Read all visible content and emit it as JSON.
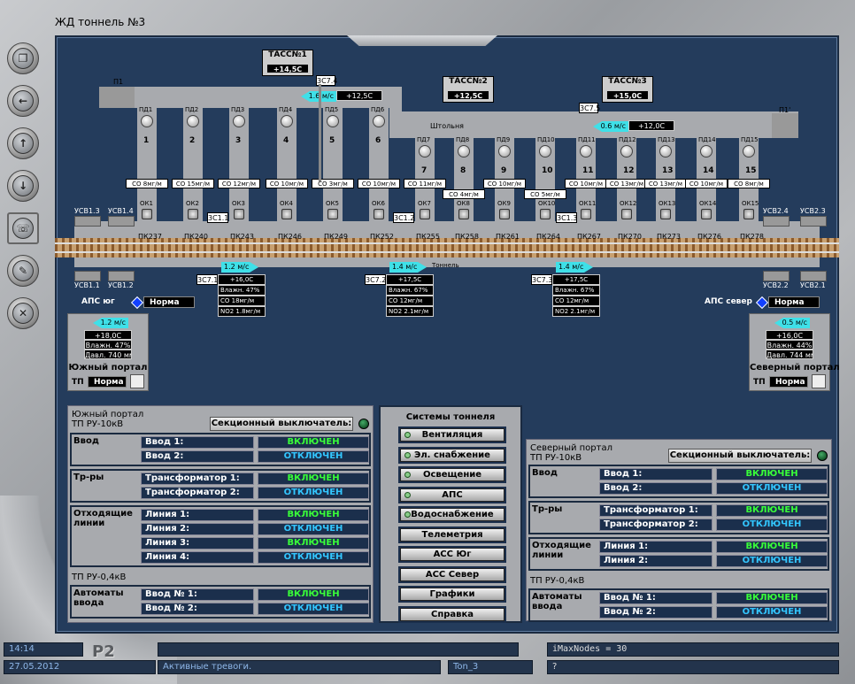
{
  "title": "ЖД тоннель №3",
  "sidebar": [
    "windows-icon",
    "back-icon",
    "up-icon",
    "down-icon",
    "alarm-icon",
    "report-icon",
    "disabled-icon"
  ],
  "tass": [
    {
      "name": "ТАСС№1",
      "temp": "+14,5С"
    },
    {
      "name": "ТАСС№2",
      "temp": "+12,5С"
    },
    {
      "name": "ТАСС№3",
      "temp": "+15,0С"
    }
  ],
  "top": {
    "p1": "П1",
    "p1r": "П1'",
    "sc74": "3С7.4",
    "sc75": "3С7.5",
    "air1_speed": "1.6 м/с",
    "air1_temp": "+12,5С",
    "air2_speed": "0.6 м/с",
    "air2_temp": "+12,0С",
    "shaft": "Штольня"
  },
  "shafts": [
    {
      "pd": "ПД1",
      "n": "1",
      "co": "СО 8мг/м",
      "ok": "ОК1"
    },
    {
      "pd": "ПД2",
      "n": "2",
      "co": "СО 15мг/м",
      "ok": "ОК2"
    },
    {
      "pd": "ПД3",
      "n": "3",
      "co": "СО 12мг/м",
      "ok": "ОК3"
    },
    {
      "pd": "ПД4",
      "n": "4",
      "co": "СО 10мг/м",
      "ok": "ОК4"
    },
    {
      "pd": "ПД5",
      "n": "5",
      "co": "СО 3мг/м",
      "ok": "ОК5"
    },
    {
      "pd": "ПД6",
      "n": "6",
      "co": "СО 10мг/м",
      "ok": "ОК6"
    },
    {
      "pd": "ПД7",
      "n": "7",
      "co": "СО 11мг/м",
      "ok": "ОК7"
    },
    {
      "pd": "ПД8",
      "n": "8",
      "co": "СО 4мг/м",
      "ok": "ОК8"
    },
    {
      "pd": "ПД9",
      "n": "9",
      "co": "СО 10мг/м",
      "ok": "ОК9"
    },
    {
      "pd": "ПД10",
      "n": "10",
      "co": "СО 5мг/м",
      "ok": "ОК10"
    },
    {
      "pd": "ПД11",
      "n": "11",
      "co": "СО 10мг/м",
      "ok": "ОК11"
    },
    {
      "pd": "ПД12",
      "n": "12",
      "co": "СО 13мг/м",
      "ok": "ОК12"
    },
    {
      "pd": "ПД13",
      "n": "13",
      "co": "СО 13мг/м",
      "ok": "ОК13"
    },
    {
      "pd": "ПД14",
      "n": "14",
      "co": "СО 10мг/м",
      "ok": "ОК14"
    },
    {
      "pd": "ПД15",
      "n": "15",
      "co": "СО 8мг/м",
      "ok": "ОК15"
    }
  ],
  "pk": [
    "ПК237",
    "ПК240",
    "ПК243",
    "ПК246",
    "ПК249",
    "ПК252",
    "ПК255",
    "ПК258",
    "ПК261",
    "ПК264",
    "ПК267",
    "ПК270",
    "ПК273",
    "ПК276",
    "ПК278"
  ],
  "sc": {
    "s71": "3С1.1",
    "s72": "3С1.2",
    "s73": "3С1.3"
  },
  "usv": {
    "u13": "УСВ1.3",
    "u14": "УСВ1.4",
    "u11": "УСВ1.1",
    "u12": "УСВ1.2",
    "u24": "УСВ2.4",
    "u23": "УСВ2.3",
    "u22": "УСВ2.2",
    "u21": "УСВ2.1"
  },
  "tunnel_label": "Тоннель",
  "sensors": [
    {
      "id": "3С7.1",
      "speed": "1.2 м/с",
      "temp": "+16,0С",
      "hum": "Влажн. 47%",
      "co": "СО 18мг/м",
      "no2": "NO2 1.8мг/м"
    },
    {
      "id": "3С7.2",
      "speed": "1.4 м/с",
      "temp": "+17,5С",
      "hum": "Влажн. 67%",
      "co": "СО 12мг/м",
      "no2": "NO2 2.1мг/м"
    },
    {
      "id": "3С7.3",
      "speed": "1.4 м/с",
      "temp": "+17,5С",
      "hum": "Влажн. 67%",
      "co": "СО 12мг/м",
      "no2": "NO2 2.1мг/м"
    }
  ],
  "aps": {
    "south": "АПС юг",
    "north": "АПС север",
    "state": "Норма"
  },
  "south_portal": {
    "speed": "1.2 м/с",
    "temp": "+18,0С",
    "hum": "Влажн. 47%",
    "press": "Давл. 740 мм",
    "name": "Южный портал",
    "tp": "ТП",
    "tp_state": "Норма"
  },
  "north_portal": {
    "speed": "0.5 м/с",
    "temp": "+16,0С",
    "hum": "Влажн. 44%",
    "press": "Давл. 744 мм",
    "name": "Северный портал",
    "tp": "ТП",
    "tp_state": "Норма"
  },
  "labels": {
    "sec_switch": "Секционный выключатель:",
    "vvod": "Ввод",
    "trans": "Тр-ры",
    "lines": "Отходящие линии",
    "tp04": "ТП РУ-0,4кВ",
    "auto": "Автоматы ввода",
    "on": "ВКЛЮЧЕН",
    "off": "ОТКЛЮЧЕН"
  },
  "south": {
    "title": "Южный портал\nТП РУ-10кВ",
    "vvod": [
      [
        "Ввод 1:",
        "on"
      ],
      [
        "Ввод 2:",
        "off"
      ]
    ],
    "trans": [
      [
        "Трансформатор 1:",
        "on"
      ],
      [
        "Трансформатор 2:",
        "off"
      ]
    ],
    "lines": [
      [
        "Линия 1:",
        "on"
      ],
      [
        "Линия 2:",
        "off"
      ],
      [
        "Линия 3:",
        "on"
      ],
      [
        "Линия 4:",
        "off"
      ]
    ],
    "auto": [
      [
        "Ввод № 1:",
        "on"
      ],
      [
        "Ввод № 2:",
        "off"
      ]
    ]
  },
  "north": {
    "title": "Северный портал\nТП РУ-10кВ",
    "vvod": [
      [
        "Ввод 1:",
        "on"
      ],
      [
        "Ввод 2:",
        "off"
      ]
    ],
    "trans": [
      [
        "Трансформатор 1:",
        "on"
      ],
      [
        "Трансформатор 2:",
        "off"
      ]
    ],
    "lines": [
      [
        "Линия 1:",
        "on"
      ],
      [
        "Линия 2:",
        "off"
      ]
    ],
    "auto": [
      [
        "Ввод № 1:",
        "on"
      ],
      [
        "Ввод № 2:",
        "off"
      ]
    ]
  },
  "systems": {
    "title": "Системы тоннеля",
    "items": [
      "Вентиляция",
      "Эл. снабжение",
      "Освещение",
      "АПС",
      "Водоснабжение",
      "Телеметрия",
      "АСС Юг",
      "АСС Север",
      "Графики",
      "Справка"
    ]
  },
  "status": {
    "time": "14:14",
    "date": "27.05.2012",
    "brand": "P2",
    "alarms": "Активные тревоги.",
    "ton": "Ton_3",
    "nodes": "iMaxNodes = 30",
    "help": "?"
  }
}
